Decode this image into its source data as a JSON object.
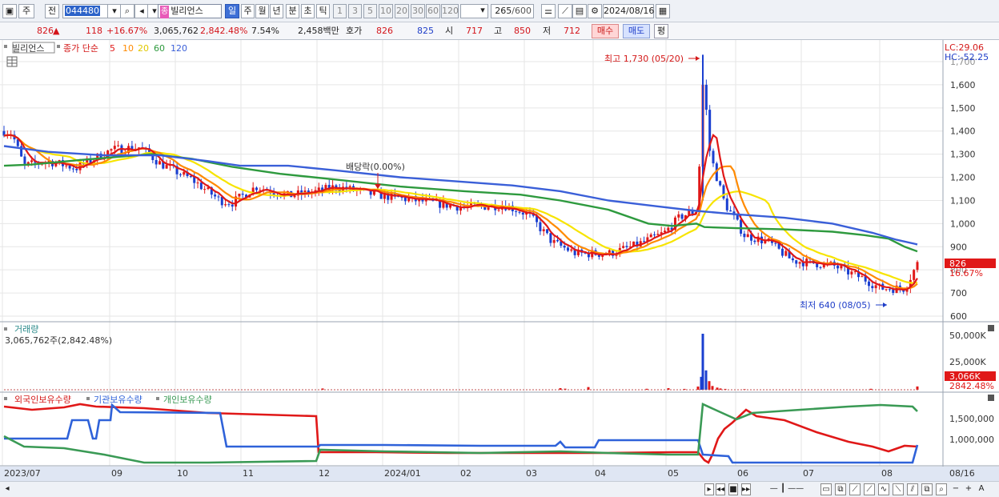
{
  "toolbar": {
    "period_daily": "주",
    "period_prev": "전",
    "stock_code": "044480",
    "stock_badge": "종",
    "stock_name": "빌리언스",
    "tabs": [
      "일",
      "주",
      "월",
      "년",
      "분",
      "초",
      "틱"
    ],
    "intervals": [
      "1",
      "3",
      "5",
      "10",
      "20",
      "30",
      "60",
      "120"
    ],
    "count_value": "265",
    "count_total": "/600",
    "date": "2024/08/16"
  },
  "quote": {
    "price": "826",
    "arrow": "▲",
    "change": "118",
    "change_pct": "+16.67%",
    "volume": "3,065,762",
    "volume_pct": "2,842.48%",
    "turnover": "7.54%",
    "amount": "2,458백만",
    "bidask_label": "호가",
    "ask": "826",
    "bid": "825",
    "open_label": "시",
    "open": "717",
    "high_label": "고",
    "high": "850",
    "low_label": "저",
    "low": "712",
    "buy_button": "매수",
    "sell_button": "매도",
    "eval_button": "평"
  },
  "price_pane": {
    "stock_name": "빌리언스",
    "ma_label": "종가 단순",
    "ma_periods": [
      "5",
      "10",
      "20",
      "60",
      "120"
    ],
    "lc": "LC:29.06",
    "hc": "HC:-52.25",
    "max_label": "최고 1,730 (05/20)",
    "min_label": "최저 640 (08/05)",
    "dividend_label": "배당락(0.00%)",
    "last_price_tag": "826",
    "last_change_tag": "16.67%",
    "y_ticks": [
      "1,600",
      "1,500",
      "1,400",
      "1,300",
      "1,200",
      "1,100",
      "1,000",
      "900",
      "700",
      "600"
    ],
    "y_ticks_partial": [
      "1,700",
      "800"
    ]
  },
  "volume_pane": {
    "title": "거래량",
    "value_label": "3,065,762주(2,842.48%)",
    "y_ticks": [
      "50,000K",
      "25,000K"
    ],
    "last_tag": "3,066K",
    "last_pct_tag": "2842.48%"
  },
  "holding_pane": {
    "legend": [
      "외국인보유수량",
      "기관보유수량",
      "개인보유수량"
    ],
    "y_ticks": [
      "1,500,000",
      "1,000,000"
    ]
  },
  "x_axis": {
    "labels": [
      "2023/07",
      "09",
      "10",
      "11",
      "12",
      "2024/01",
      "02",
      "03",
      "04",
      "05",
      "06",
      "07",
      "08",
      "08/16"
    ]
  },
  "colors": {
    "up": "#e01818",
    "down": "#1a3fd0",
    "ma5": "#e01818",
    "ma10": "#ff8a00",
    "ma20": "#f7e400",
    "ma60": "#2e9a3e",
    "ma120": "#3a5fd8",
    "foreign": "#e01818",
    "institution": "#2f62d9",
    "individual": "#3a9a55"
  },
  "chart_data": {
    "type": "line",
    "title": "빌리언스",
    "x": [
      "2023/07",
      "09",
      "10",
      "11",
      "12",
      "2024/01",
      "02",
      "03",
      "04",
      "05",
      "06",
      "07",
      "08",
      "08/16"
    ],
    "series": [
      {
        "name": "종가",
        "values": [
          1400,
          1320,
          1330,
          1240,
          1180,
          1150,
          1110,
          1080,
          930,
          870,
          1040,
          1730,
          1050,
          930,
          840,
          790,
          720,
          826
        ]
      },
      {
        "name": "120",
        "values": [
          1330,
          1310,
          1300,
          1290,
          1260,
          1250,
          1220,
          1180,
          1140,
          1100,
          1050,
          1040,
          1010,
          980,
          940,
          910
        ]
      },
      {
        "name": "60",
        "values": [
          1250,
          1270,
          1300,
          1270,
          1220,
          1180,
          1140,
          1110,
          1080,
          1000,
          950,
          980,
          980,
          960,
          900,
          830
        ]
      }
    ],
    "ylim": [
      600,
      1730
    ],
    "volume": {
      "name": "거래량",
      "peak_label": "50,000K",
      "last": "3,066K"
    },
    "holdings": {
      "series": [
        "외국인보유수량",
        "기관보유수량",
        "개인보유수량"
      ],
      "ticks": [
        "1,500,000",
        "1,000,000"
      ]
    }
  }
}
